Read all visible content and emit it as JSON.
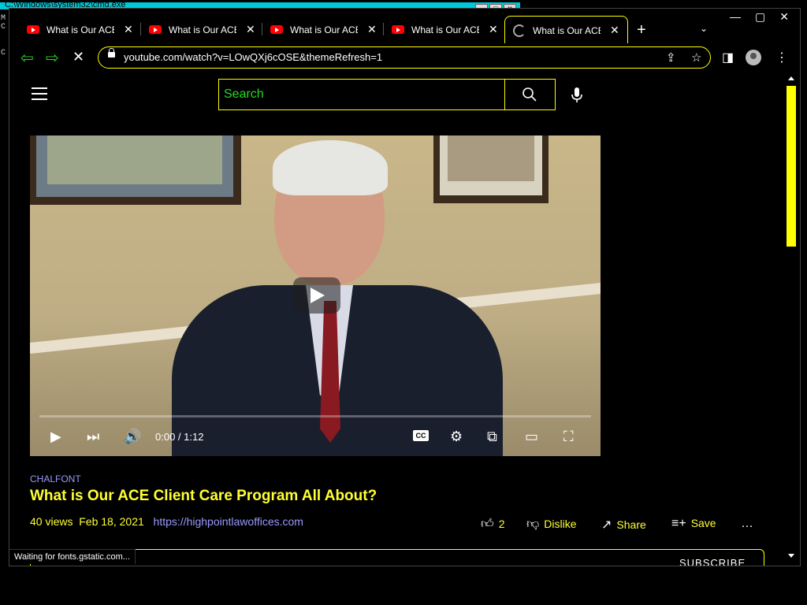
{
  "cmd": {
    "title": "C:\\Windows\\system32\\cmd.exe",
    "left_chars": [
      "M",
      "C",
      "",
      "C"
    ]
  },
  "tabs": [
    {
      "title": "What is Our ACE Client Care Program All About?",
      "active": false
    },
    {
      "title": "What is Our ACE Client Care Program All About?",
      "active": false
    },
    {
      "title": "What is Our ACE Client Care Program All About?",
      "active": false
    },
    {
      "title": "What is Our ACE Client Care Program All About?",
      "active": false
    },
    {
      "title": "What is Our ACE Client Care Program All About?",
      "active": true,
      "loading": true
    }
  ],
  "toolbar": {
    "url": "youtube.com/watch?v=LOwQXj6cOSE&themeRefresh=1"
  },
  "page": {
    "search_placeholder": "Search",
    "player": {
      "time": "0:00 / 1:12",
      "progress": 0
    },
    "channel": "CHALFONT",
    "title": "What is Our ACE Client Care Program All About?",
    "views": "40 views",
    "date": "Feb 18, 2021",
    "link": "https://highpointlawoffices.com",
    "likes": "2",
    "dislike_label": "Dislike",
    "share_label": "Share",
    "save_label": "Save",
    "subscribe_label": "SUBSCRIBE"
  },
  "statusbar": {
    "text": "Waiting for fonts.gstatic.com..."
  },
  "colors": {
    "accent_yellow": "#ffff00",
    "link_blue": "#9999ff",
    "nav_green": "#22dd22",
    "yt_red": "#ff0000"
  }
}
